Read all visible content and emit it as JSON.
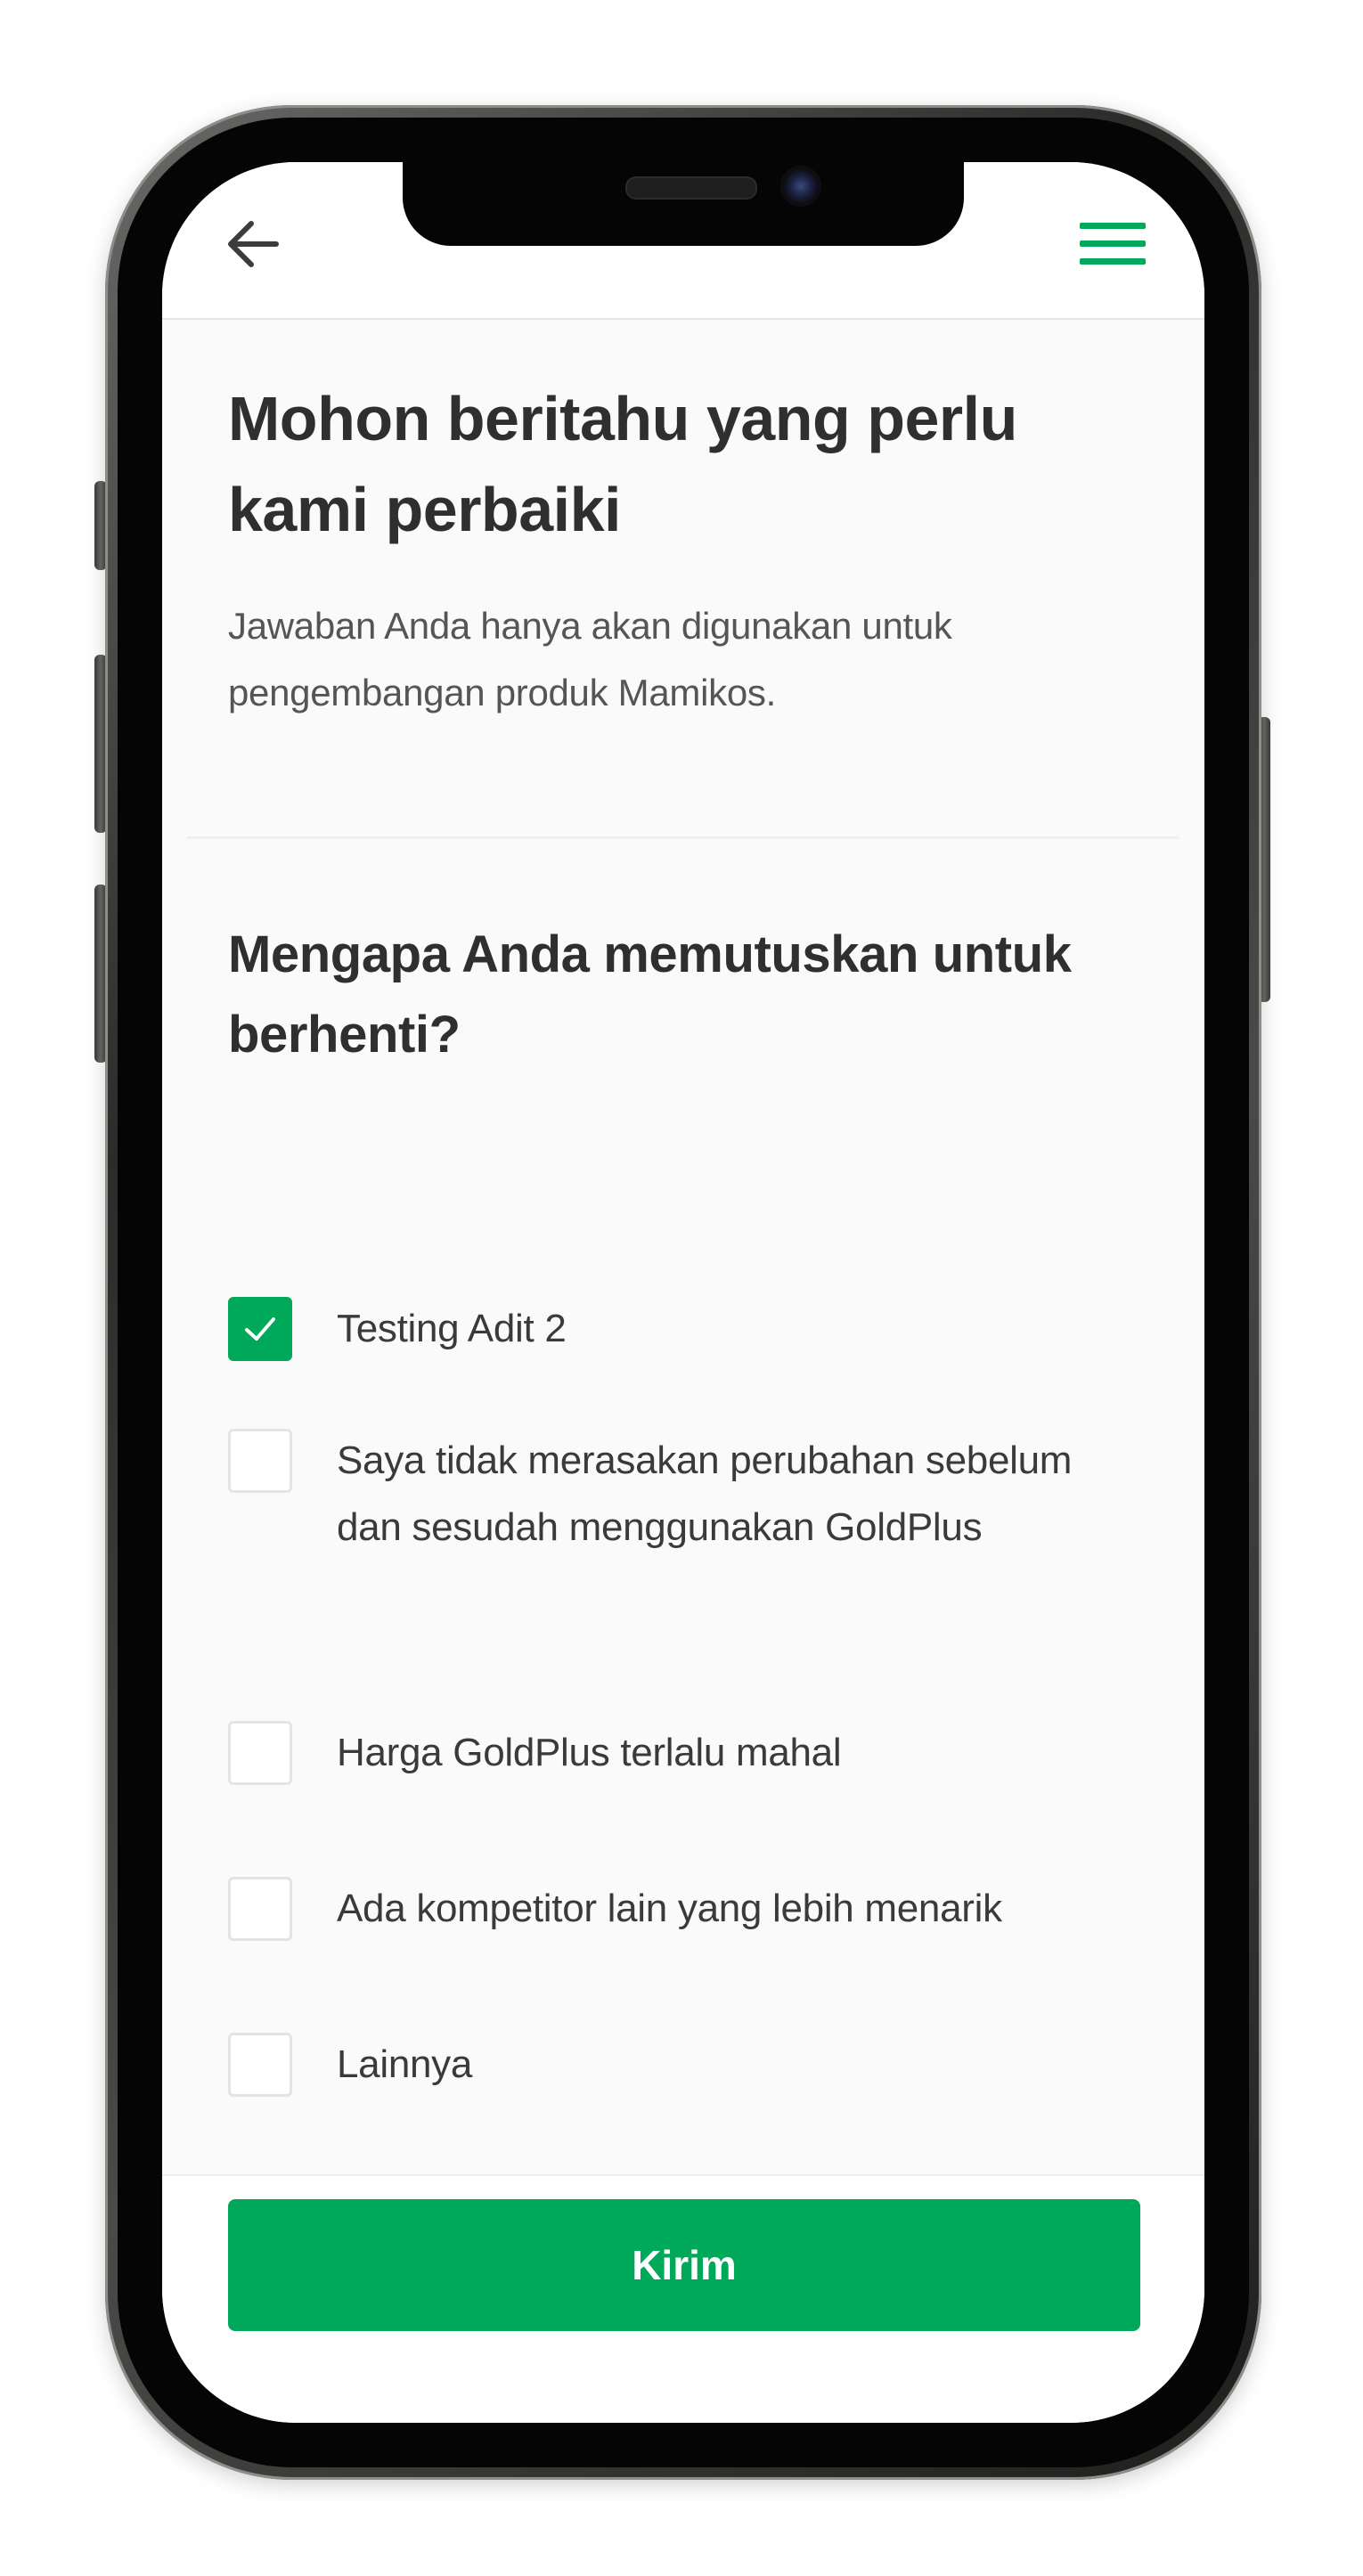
{
  "header": {
    "back_icon": "arrow-left-icon",
    "menu_icon": "hamburger-menu-icon"
  },
  "intro": {
    "title": "Mohon beritahu yang perlu kami perbaiki",
    "subtitle": "Jawaban Anda hanya akan digunakan untuk pengembangan produk Mamikos."
  },
  "survey": {
    "question": "Mengapa Anda memutuskan untuk berhenti?",
    "options": [
      {
        "label": "Testing Adit 2",
        "checked": true
      },
      {
        "label": "Saya tidak merasakan perubahan sebelum dan sesudah menggunakan GoldPlus",
        "checked": false
      },
      {
        "label": "Harga GoldPlus terlalu mahal",
        "checked": false
      },
      {
        "label": "Ada kompetitor lain yang lebih menarik",
        "checked": false
      },
      {
        "label": "Lainnya",
        "checked": false
      }
    ]
  },
  "footer": {
    "submit_label": "Kirim"
  },
  "colors": {
    "accent": "#00A85A",
    "title_text": "#2F2F2F",
    "body_text": "#555555"
  }
}
